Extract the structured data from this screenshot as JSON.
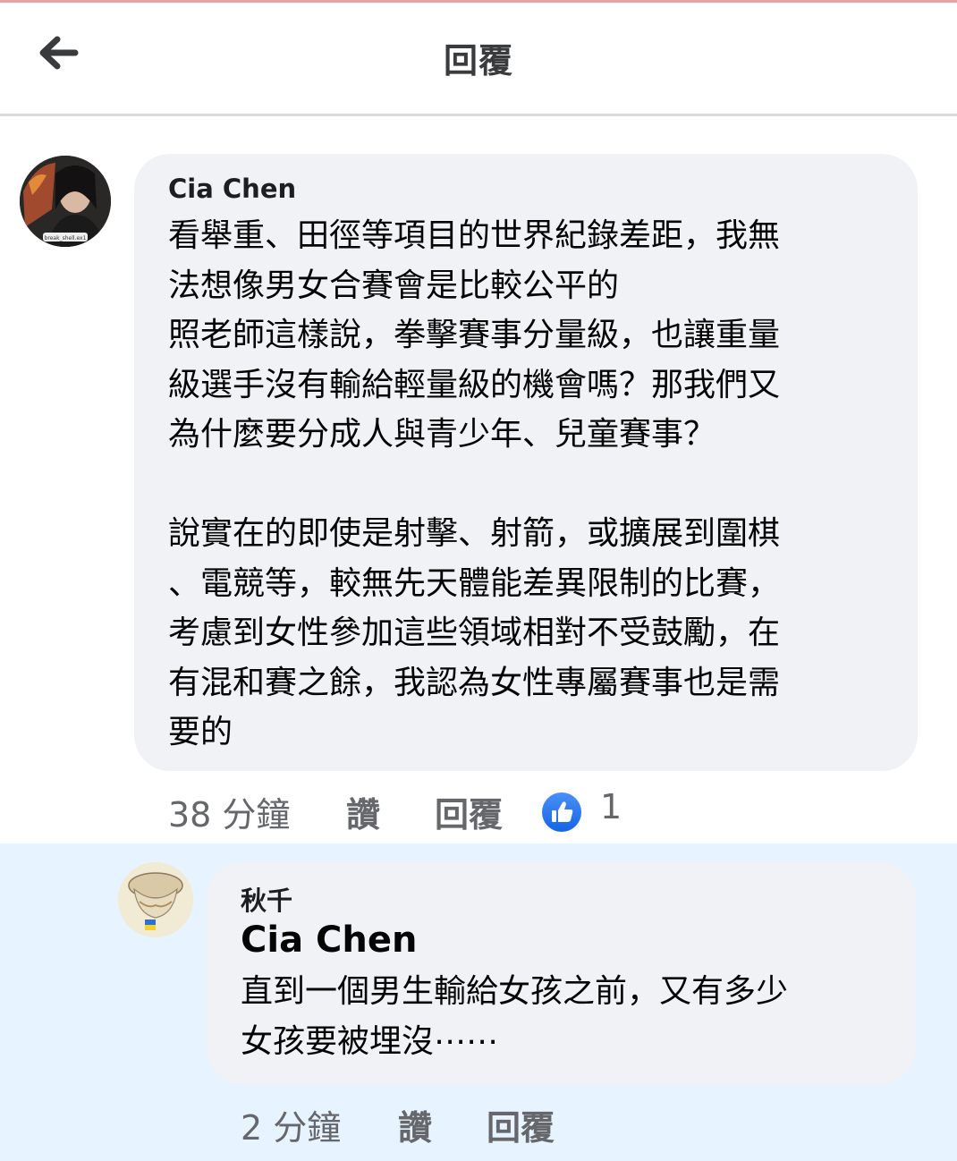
{
  "header": {
    "title": "回覆"
  },
  "comment": {
    "author": "Cia Chen",
    "text": "看舉重、田徑等項目的世界紀錄差距，我無\n法想像男女合賽會是比較公平的\n照老師這樣說，拳擊賽事分量級，也讓重量\n級選手沒有輸給輕量級的機會嗎？那我們又\n為什麼要分成人與青少年、兒童賽事？\n\n說實在的即使是射擊、射箭，或擴展到圍棋\n、電競等，較無先天體能差異限制的比賽，\n考慮到女性參加這些領域相對不受鼓勵，在\n有混和賽之餘，我認為女性專屬賽事也是需\n要的",
    "time": "38 分鐘",
    "like_label": "讚",
    "reply_label": "回覆",
    "reaction_count": "1"
  },
  "reply": {
    "author": "秋千",
    "mention": "Cia Chen",
    "text": "直到一個男生輸給女孩之前，又有多少\n女孩要被埋沒⋯⋯",
    "time": "2 分鐘",
    "like_label": "讚",
    "reply_label": "回覆"
  },
  "avatar_badge_text": "break_shell.ex1"
}
